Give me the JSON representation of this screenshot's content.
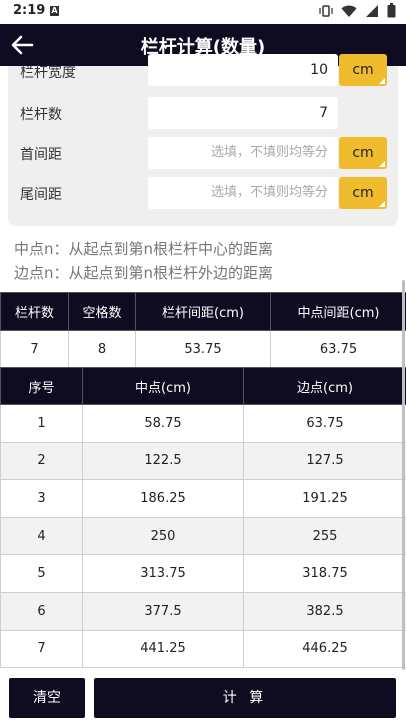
{
  "status_bar": {
    "time": "2:19",
    "a_icon": "A"
  },
  "app_bar": {
    "title": "栏杆计算(数量)"
  },
  "form": {
    "rows": [
      {
        "label": "栏杆宽度",
        "value": "10",
        "placeholder": "",
        "unit": "cm"
      },
      {
        "label": "栏杆数",
        "value": "7",
        "placeholder": ""
      },
      {
        "label": "首间距",
        "value": "",
        "placeholder": "选填，不填则均等分",
        "unit": "cm"
      },
      {
        "label": "尾间距",
        "value": "",
        "placeholder": "选填，不填则均等分",
        "unit": "cm"
      }
    ]
  },
  "descriptions": {
    "mid": "中点n：从起点到第n根栏杆中心的距离",
    "edge": "边点n：从起点到第n根栏杆外边的距离"
  },
  "summary_table": {
    "headers": [
      "栏杆数",
      "空格数",
      "栏杆间距(cm)",
      "中点间距(cm)"
    ],
    "row": [
      "7",
      "8",
      "53.75",
      "63.75"
    ]
  },
  "detail_table": {
    "headers": [
      "序号",
      "中点(cm)",
      "边点(cm)"
    ],
    "rows": [
      [
        "1",
        "58.75",
        "63.75"
      ],
      [
        "2",
        "122.5",
        "127.5"
      ],
      [
        "3",
        "186.25",
        "191.25"
      ],
      [
        "4",
        "250",
        "255"
      ],
      [
        "5",
        "313.75",
        "318.75"
      ],
      [
        "6",
        "377.5",
        "382.5"
      ],
      [
        "7",
        "441.25",
        "446.25"
      ]
    ]
  },
  "buttons": {
    "clear": "清空",
    "calculate": "计 算"
  },
  "colors": {
    "appbar": "#0f0c21",
    "unit_button": "#f0bc2e"
  }
}
